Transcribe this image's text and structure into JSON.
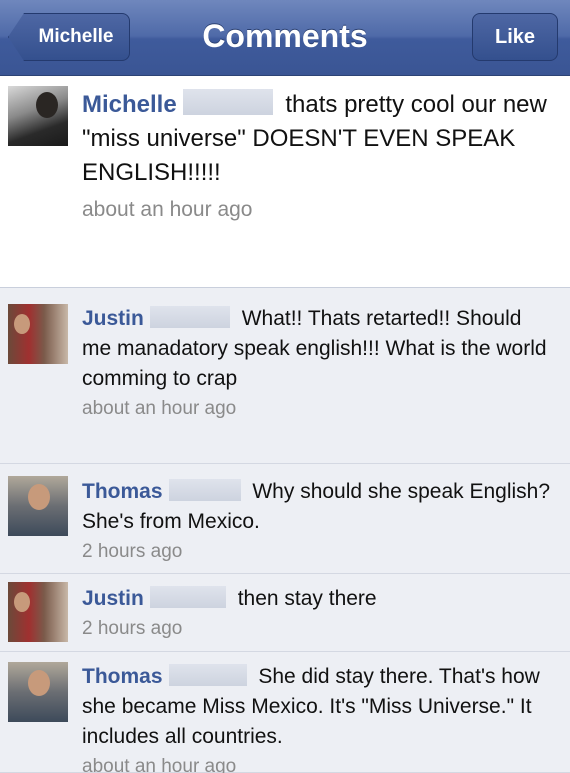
{
  "navbar": {
    "back_label": "Michelle",
    "title": "Comments",
    "like_label": "Like"
  },
  "post": {
    "author": "Michelle",
    "text": "thats pretty cool our new \"miss universe\" DOESN'T EVEN SPEAK ENGLISH!!!!!",
    "time": "about an hour ago"
  },
  "comments": [
    {
      "author": "Justin",
      "text": "What!! Thats retarted!! Should me manadatory speak english!!! What is the world comming to crap",
      "time": "about an hour ago"
    },
    {
      "author": "Thomas",
      "text": "Why should she speak English? She's from Mexico.",
      "time": "2 hours ago"
    },
    {
      "author": "Justin",
      "text": "then stay there",
      "time": "2 hours ago"
    },
    {
      "author": "Thomas",
      "text": "She did stay there. That's how she became Miss Mexico. It's \"Miss Universe.\" It includes all countries.",
      "time": "about an hour ago"
    }
  ]
}
